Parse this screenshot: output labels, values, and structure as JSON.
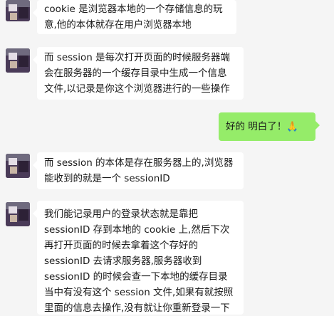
{
  "conversation": {
    "messages": [
      {
        "sender": "other",
        "lines": [
          "cookie 是浏览器本地的一个存储信息的玩",
          "意,他的本体就存在用户浏览器本地"
        ]
      },
      {
        "sender": "other",
        "lines": [
          "而 session 是每次打开页面的时候服务器端",
          "会在服务器的一个缓存目录中生成一个信息",
          "文件,以记录是你这个浏览器进行的一些操作"
        ]
      },
      {
        "sender": "self",
        "lines": [
          "好的 明白了！🙏"
        ]
      },
      {
        "sender": "other",
        "lines": [
          "而 session 的本体是存在服务器上的,浏览器",
          "能收到的就是一个 sessionID"
        ]
      },
      {
        "sender": "other",
        "lines": [
          "我们能记录用户的登录状态就是靠把",
          "sessionID 存到本地的 cookie 上,然后下次",
          "再打开页面的时候去拿着这个存好的",
          "sessionID 去请求服务器,服务器收到",
          "sessionID 的时候会查一下本地的缓存目录",
          "当中有没有这个 session 文件,如果有就按照",
          "里面的信息去操作,没有就让你重新登录一下"
        ]
      }
    ]
  },
  "colors": {
    "background": "#f5f5f5",
    "incoming_bubble": "#ffffff",
    "outgoing_bubble": "#95ec69"
  }
}
